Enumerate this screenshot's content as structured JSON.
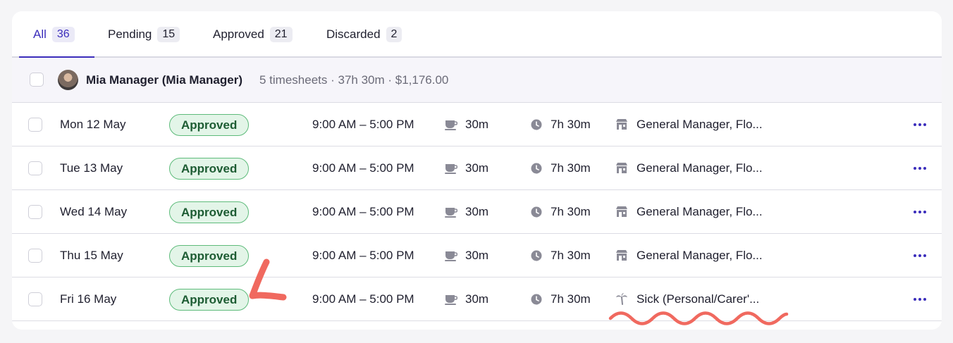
{
  "tabs": [
    {
      "label": "All",
      "count": "36",
      "active": true
    },
    {
      "label": "Pending",
      "count": "15",
      "active": false
    },
    {
      "label": "Approved",
      "count": "21",
      "active": false
    },
    {
      "label": "Discarded",
      "count": "2",
      "active": false
    }
  ],
  "group": {
    "name": "Mia Manager (Mia Manager)",
    "meta": "5 timesheets · 37h 30m · $1,176.00"
  },
  "rows": [
    {
      "date": "Mon 12 May",
      "status": "Approved",
      "time": "9:00 AM – 5:00 PM",
      "break": "30m",
      "duration": "7h 30m",
      "location_icon": "store-icon",
      "location": "General Manager, Flo..."
    },
    {
      "date": "Tue 13 May",
      "status": "Approved",
      "time": "9:00 AM – 5:00 PM",
      "break": "30m",
      "duration": "7h 30m",
      "location_icon": "store-icon",
      "location": "General Manager, Flo..."
    },
    {
      "date": "Wed 14 May",
      "status": "Approved",
      "time": "9:00 AM – 5:00 PM",
      "break": "30m",
      "duration": "7h 30m",
      "location_icon": "store-icon",
      "location": "General Manager, Flo..."
    },
    {
      "date": "Thu 15 May",
      "status": "Approved",
      "time": "9:00 AM – 5:00 PM",
      "break": "30m",
      "duration": "7h 30m",
      "location_icon": "store-icon",
      "location": "General Manager, Flo..."
    },
    {
      "date": "Fri 16 May",
      "status": "Approved",
      "time": "9:00 AM – 5:00 PM",
      "break": "30m",
      "duration": "7h 30m",
      "location_icon": "palm-tree-icon",
      "location": "Sick (Personal/Carer'..."
    }
  ],
  "colors": {
    "accent": "#3b2dbb",
    "approved_bg": "#e3f5e8",
    "approved_border": "#5dbb7a",
    "annotation": "#f0695f"
  }
}
